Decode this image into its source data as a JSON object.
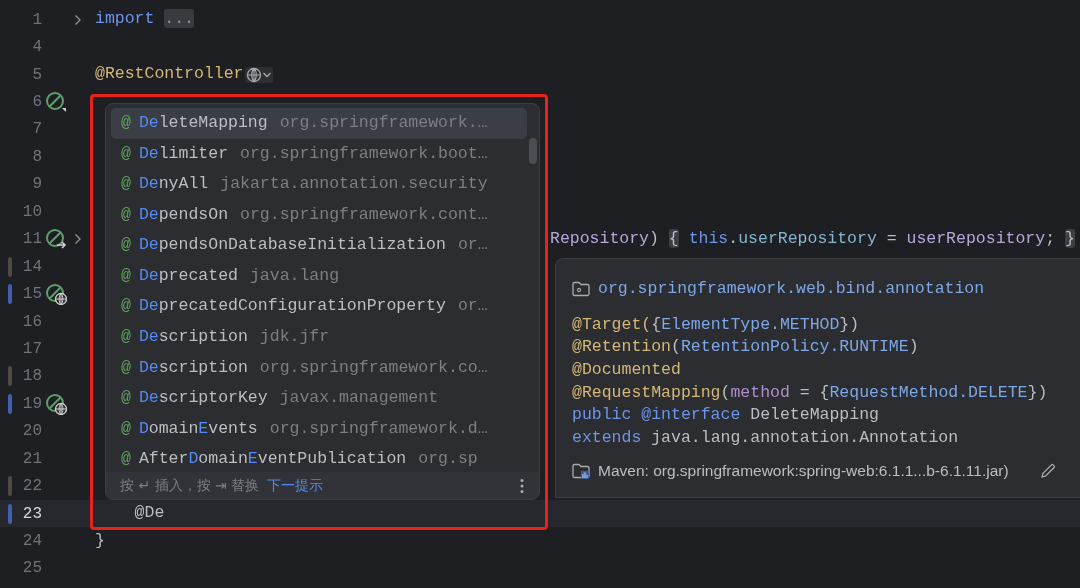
{
  "editor": {
    "lines": [
      {
        "number": "1",
        "current": false,
        "fold": true,
        "tokens": [
          {
            "kind": "keyword",
            "text": "import "
          },
          {
            "kind": "folded",
            "text": "..."
          }
        ]
      },
      {
        "number": "4",
        "current": false
      },
      {
        "number": "5",
        "current": false,
        "inlay": true,
        "tokens": [
          {
            "kind": "annotation",
            "text": "@RestController"
          }
        ]
      },
      {
        "number": "6",
        "current": false,
        "gutter_icon": {
          "kind": "bean"
        }
      },
      {
        "number": "7",
        "current": false
      },
      {
        "number": "8",
        "current": false
      },
      {
        "number": "9",
        "current": false
      },
      {
        "number": "10",
        "current": false
      },
      {
        "number": "11",
        "current": false,
        "gutter_icon": {
          "kind": "bean-implements"
        },
        "fold": true,
        "clipped": true,
        "tokens": [
          {
            "kind": "param",
            "text": "Repository"
          },
          {
            "kind": "plain",
            "text": ") "
          },
          {
            "kind": "brace",
            "text": "{"
          },
          {
            "kind": "keyword",
            "text": " this"
          },
          {
            "kind": "plain",
            "text": "."
          },
          {
            "kind": "field",
            "text": "userRepository"
          },
          {
            "kind": "plain",
            "text": " = "
          },
          {
            "kind": "param",
            "text": "userRepository"
          },
          {
            "kind": "plain",
            "text": "; "
          },
          {
            "kind": "brace",
            "text": "}"
          }
        ]
      },
      {
        "number": "14",
        "current": false,
        "color": "#4e4943"
      },
      {
        "number": "15",
        "current": false,
        "color": "#3f5fb0",
        "gutter_icon": {
          "kind": "endpoint"
        }
      },
      {
        "number": "16",
        "current": false
      },
      {
        "number": "17",
        "current": false
      },
      {
        "number": "18",
        "current": false,
        "color": "#4e4943"
      },
      {
        "number": "19",
        "current": false,
        "color": "#3f5fb0",
        "gutter_icon": {
          "kind": "endpoint"
        }
      },
      {
        "number": "20",
        "current": false
      },
      {
        "number": "21",
        "current": false
      },
      {
        "number": "22",
        "current": false,
        "color": "#4e4943"
      },
      {
        "number": "23",
        "current": true,
        "color": "#3f5fb0",
        "tokens": [
          {
            "kind": "plain",
            "text": "    @De"
          }
        ]
      },
      {
        "number": "24",
        "current": false,
        "tokens": [
          {
            "kind": "plain",
            "text": "}"
          }
        ]
      },
      {
        "number": "25",
        "current": false
      }
    ]
  },
  "completion": {
    "items": [
      {
        "icon": "@",
        "selected": true,
        "parts": [
          {
            "text": "De",
            "match": true
          },
          {
            "text": "leteMapping",
            "match": false
          }
        ],
        "type": "org.springframework.…"
      },
      {
        "icon": "@",
        "selected": false,
        "parts": [
          {
            "text": "De",
            "match": true
          },
          {
            "text": "limiter",
            "match": false
          }
        ],
        "type": "org.springframework.boot…"
      },
      {
        "icon": "@",
        "selected": false,
        "parts": [
          {
            "text": "De",
            "match": true
          },
          {
            "text": "nyAll",
            "match": false
          }
        ],
        "type": "jakarta.annotation.security"
      },
      {
        "icon": "@",
        "selected": false,
        "parts": [
          {
            "text": "De",
            "match": true
          },
          {
            "text": "pendsOn",
            "match": false
          }
        ],
        "type": "org.springframework.cont…"
      },
      {
        "icon": "@",
        "selected": false,
        "parts": [
          {
            "text": "De",
            "match": true
          },
          {
            "text": "pendsOnDatabaseInitialization",
            "match": false
          }
        ],
        "type": "or…"
      },
      {
        "icon": "@",
        "selected": false,
        "parts": [
          {
            "text": "De",
            "match": true
          },
          {
            "text": "precated",
            "match": false
          }
        ],
        "type": "java.lang"
      },
      {
        "icon": "@",
        "selected": false,
        "parts": [
          {
            "text": "De",
            "match": true
          },
          {
            "text": "precatedConfigurationProperty",
            "match": false
          }
        ],
        "type": "or…"
      },
      {
        "icon": "@",
        "selected": false,
        "parts": [
          {
            "text": "De",
            "match": true
          },
          {
            "text": "scription",
            "match": false
          }
        ],
        "type": "jdk.jfr"
      },
      {
        "icon": "@",
        "selected": false,
        "parts": [
          {
            "text": "De",
            "match": true
          },
          {
            "text": "scription",
            "match": false
          }
        ],
        "type": "org.springframework.co…"
      },
      {
        "icon": "@",
        "selected": false,
        "parts": [
          {
            "text": "De",
            "match": true
          },
          {
            "text": "scriptorKey",
            "match": false
          }
        ],
        "type": "javax.management"
      },
      {
        "icon": "@",
        "selected": false,
        "parts": [
          {
            "text": "D",
            "match": true
          },
          {
            "text": "omain",
            "match": false
          },
          {
            "text": "E",
            "match": true
          },
          {
            "text": "vents",
            "match": false
          }
        ],
        "type": "org.springframework.d…"
      },
      {
        "icon": "@",
        "selected": false,
        "parts": [
          {
            "text": "After",
            "match": false
          },
          {
            "text": "D",
            "match": true
          },
          {
            "text": "omain",
            "match": false
          },
          {
            "text": "E",
            "match": true
          },
          {
            "text": "ventPublication",
            "match": false
          }
        ],
        "type": "org.sp"
      }
    ],
    "hint": "按 ↵ 插入，按 ⇥ 替换",
    "next_hint_link": "下一提示"
  },
  "documentation": {
    "package": "org.springframework.web.bind.annotation",
    "lines": [
      [
        {
          "kind": "annotation",
          "text": "@Target("
        },
        {
          "kind": "plain",
          "text": "{"
        },
        {
          "kind": "link",
          "text": "ElementType.METHOD"
        },
        {
          "kind": "plain",
          "text": "})"
        }
      ],
      [
        {
          "kind": "annotation",
          "text": "@Retention"
        },
        {
          "kind": "plain",
          "text": "("
        },
        {
          "kind": "link",
          "text": "RetentionPolicy.RUNTIME"
        },
        {
          "kind": "plain",
          "text": ")"
        }
      ],
      [
        {
          "kind": "annotation",
          "text": "@Documented"
        }
      ],
      [
        {
          "kind": "annotation",
          "text": "@RequestMapping"
        },
        {
          "kind": "plain",
          "text": "("
        },
        {
          "kind": "attr",
          "text": "method"
        },
        {
          "kind": "plain",
          "text": " = {"
        },
        {
          "kind": "link",
          "text": "RequestMethod.DELETE"
        },
        {
          "kind": "plain",
          "text": "})"
        }
      ],
      [
        {
          "kind": "keyword",
          "text": "public @interface "
        },
        {
          "kind": "plain",
          "text": "DeleteMapping"
        }
      ],
      [
        {
          "kind": "keyword",
          "text": "extends "
        },
        {
          "kind": "plain",
          "text": "java.lang.annotation.Annotation"
        }
      ]
    ],
    "library": "Maven: org.springframework:spring-web:6.1.1...b-6.1.11.jar)"
  }
}
